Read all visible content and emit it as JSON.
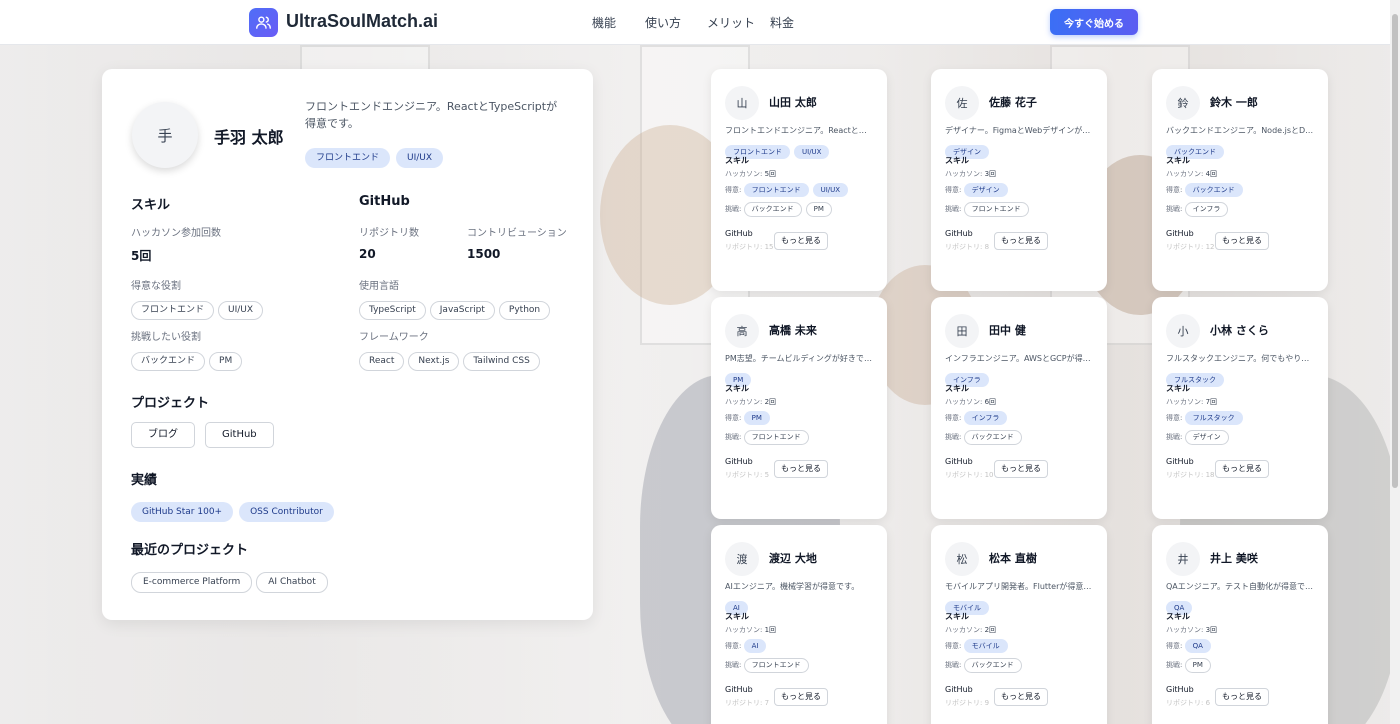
{
  "brand": {
    "name": "UltraSoulMatch.ai",
    "logo_icon": "users-icon"
  },
  "nav": [
    "機能",
    "使い方",
    "メリット",
    "料金"
  ],
  "cta_label": "今すぐ始める",
  "profile": {
    "initial": "手",
    "name": "手羽 太郎",
    "bio": "フロントエンドエンジニア。ReactとTypeScriptが得意です。",
    "tags": [
      "フロントエンド",
      "UI/UX"
    ],
    "skills_title": "スキル",
    "hackathon_label": "ハッカソン参加回数",
    "hackathon_value": "5回",
    "good_role_label": "得意な役割",
    "good_roles": [
      "フロントエンド",
      "UI/UX"
    ],
    "challenge_role_label": "挑戦したい役割",
    "challenge_roles": [
      "バックエンド",
      "PM"
    ],
    "github_title": "GitHub",
    "repo_label": "リポジトリ数",
    "repo_value": "20",
    "contrib_label": "コントリビューション",
    "contrib_value": "1500",
    "lang_label": "使用言語",
    "languages": [
      "TypeScript",
      "JavaScript",
      "Python"
    ],
    "framework_label": "フレームワーク",
    "frameworks": [
      "React",
      "Next.js",
      "Tailwind CSS"
    ],
    "project_title": "プロジェクト",
    "project_links": [
      "ブログ",
      "GitHub"
    ],
    "achievements_title": "実績",
    "achievements": [
      "GitHub Star 100+",
      "OSS Contributor"
    ],
    "recent_title": "最近のプロジェクト",
    "recent_projects": [
      "E-commerce Platform",
      "AI Chatbot"
    ]
  },
  "card_labels": {
    "skill": "スキル",
    "hackathon": "ハッカソン:",
    "good": "得意:",
    "challenge": "挑戦:",
    "github": "GitHub",
    "repo": "リポジトリ:",
    "more": "もっと見る"
  },
  "cards": [
    {
      "initial": "山",
      "name": "山田 太郎",
      "bio": "フロントエンドエンジニア。Reactと…",
      "tags": [
        "フロントエンド",
        "UI/UX"
      ],
      "hackathon": "5回",
      "good": [
        "フロントエンド",
        "UI/UX"
      ],
      "challenge": [
        "バックエンド",
        "PM"
      ],
      "repos": "15"
    },
    {
      "initial": "佐",
      "name": "佐藤 花子",
      "bio": "デザイナー。FigmaとWebデザインが得意…",
      "tags": [
        "デザイン"
      ],
      "hackathon": "3回",
      "good": [
        "デザイン"
      ],
      "challenge": [
        "フロントエンド"
      ],
      "repos": "8"
    },
    {
      "initial": "鈴",
      "name": "鈴木 一郎",
      "bio": "バックエンドエンジニア。Node.jsとDB設…",
      "tags": [
        "バックエンド"
      ],
      "hackathon": "4回",
      "good": [
        "バックエンド"
      ],
      "challenge": [
        "インフラ"
      ],
      "repos": "12"
    },
    {
      "initial": "高",
      "name": "高橋 未来",
      "bio": "PM志望。チームビルディングが好きです。",
      "tags": [
        "PM"
      ],
      "hackathon": "2回",
      "good": [
        "PM"
      ],
      "challenge": [
        "フロントエンド"
      ],
      "repos": "5"
    },
    {
      "initial": "田",
      "name": "田中 健",
      "bio": "インフラエンジニア。AWSとGCPが得意で…",
      "tags": [
        "インフラ"
      ],
      "hackathon": "6回",
      "good": [
        "インフラ"
      ],
      "challenge": [
        "バックエンド"
      ],
      "repos": "10"
    },
    {
      "initial": "小",
      "name": "小林 さくら",
      "bio": "フルスタックエンジニア。何でもやります。",
      "tags": [
        "フルスタック"
      ],
      "hackathon": "7回",
      "good": [
        "フルスタック"
      ],
      "challenge": [
        "デザイン"
      ],
      "repos": "18"
    },
    {
      "initial": "渡",
      "name": "渡辺 大地",
      "bio": "AIエンジニア。機械学習が得意です。",
      "tags": [
        "AI"
      ],
      "hackathon": "1回",
      "good": [
        "AI"
      ],
      "challenge": [
        "フロントエンド"
      ],
      "repos": "7"
    },
    {
      "initial": "松",
      "name": "松本 直樹",
      "bio": "モバイルアプリ開発者。Flutterが得意で…",
      "tags": [
        "モバイル"
      ],
      "hackathon": "2回",
      "good": [
        "モバイル"
      ],
      "challenge": [
        "バックエンド"
      ],
      "repos": "9"
    },
    {
      "initial": "井",
      "name": "井上 美咲",
      "bio": "QAエンジニア。テスト自動化が得意です。",
      "tags": [
        "QA"
      ],
      "hackathon": "3回",
      "good": [
        "QA"
      ],
      "challenge": [
        "PM"
      ],
      "repos": "6"
    }
  ],
  "colors": {
    "accent": "#3b6ff5",
    "tag_bg": "#dbe6fb",
    "tag_text": "#1e3a8a"
  }
}
